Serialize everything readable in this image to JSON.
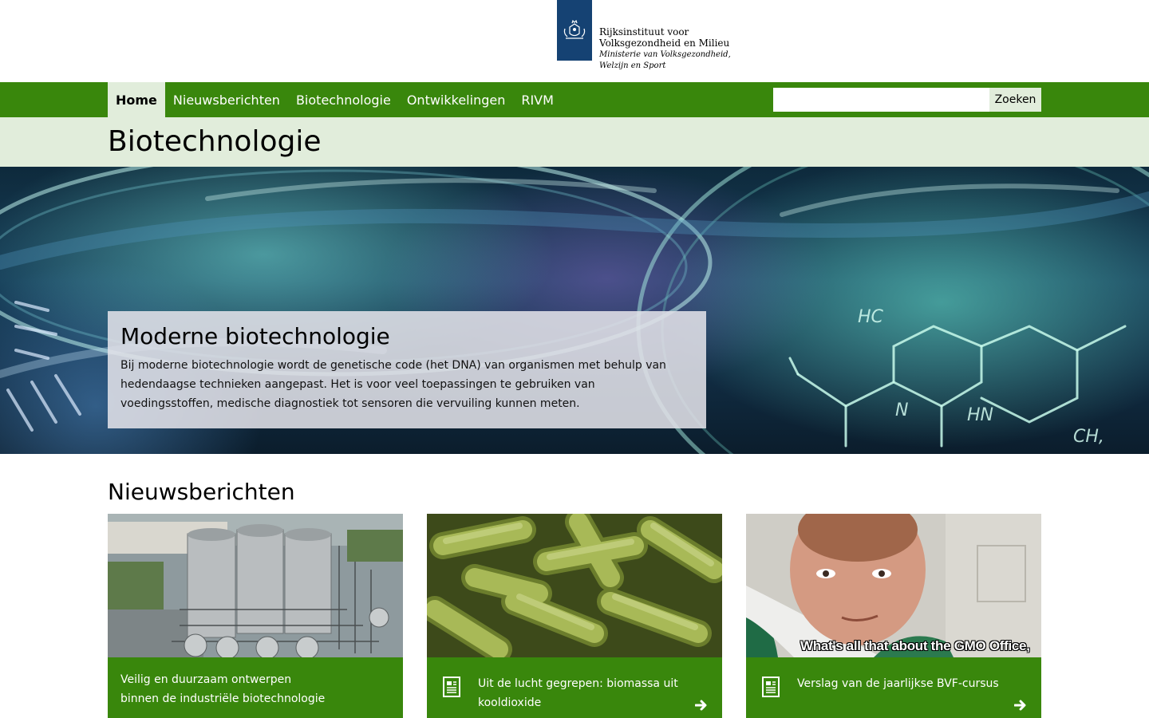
{
  "header": {
    "org_name": "Rijksinstituut voor Volksgezondheid en Milieu",
    "ministry_line1": "Ministerie van Volksgezondheid,",
    "ministry_line2": "Welzijn en Sport",
    "logo_icon": "coat-of-arms-icon"
  },
  "nav": {
    "items": [
      {
        "label": "Home",
        "active": true
      },
      {
        "label": "Nieuwsberichten",
        "active": false
      },
      {
        "label": "Biotechnologie",
        "active": false
      },
      {
        "label": "Ontwikkelingen",
        "active": false
      },
      {
        "label": "RIVM",
        "active": false
      }
    ],
    "search": {
      "value": "",
      "button_label": "Zoeken"
    }
  },
  "page": {
    "title": "Biotechnologie"
  },
  "hero": {
    "title": "Moderne biotechnologie",
    "text": "Bij moderne biotechnologie wordt de genetische code (het DNA) van organismen met behulp van hedendaagse technieken aangepast. Het is voor veel toepassingen te gebruiken van voedingsstoffen, medische diagnostiek tot sensoren die vervuiling kunnen meten.",
    "image_labels": [
      "HC",
      "N",
      "HN",
      "CH,"
    ]
  },
  "news": {
    "heading": "Nieuwsberichten",
    "cards": [
      {
        "title": "Veilig en duurzaam ontwerpen binnen de industriële biotechnologie",
        "image": "industrial-plant-photo",
        "has_icon": false
      },
      {
        "title": "Uit de lucht gegrepen: biomassa uit kooldioxide",
        "image": "bacteria-photo",
        "has_icon": true
      },
      {
        "title": "Verslag van de jaarlijkse BVF-cursus",
        "image": "scientist-photo",
        "image_caption": "What's all that about the GMO Office,",
        "has_icon": true
      }
    ]
  },
  "colors": {
    "brand_green": "#39870c",
    "light_green": "#e1eddb",
    "logo_blue": "#154273"
  }
}
